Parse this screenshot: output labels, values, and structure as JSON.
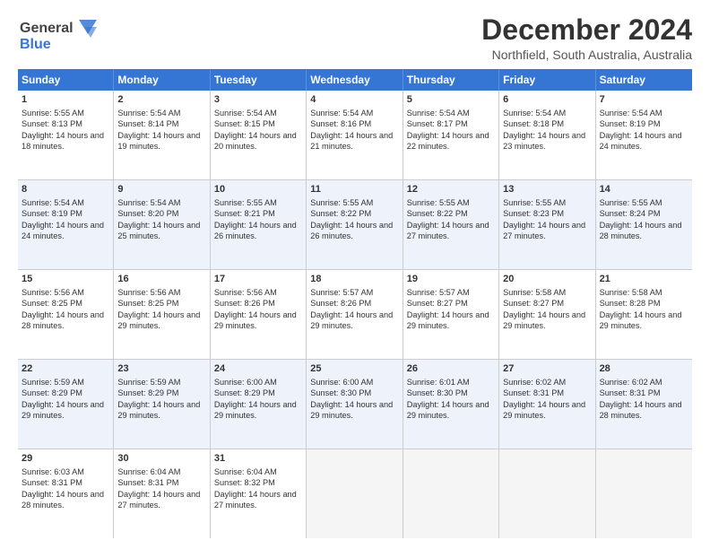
{
  "header": {
    "logo": {
      "line1": "General",
      "line2": "Blue",
      "tagline": ""
    },
    "title": "December 2024",
    "location": "Northfield, South Australia, Australia"
  },
  "calendar": {
    "days": [
      "Sunday",
      "Monday",
      "Tuesday",
      "Wednesday",
      "Thursday",
      "Friday",
      "Saturday"
    ],
    "rows": [
      [
        {
          "day": 1,
          "sunrise": "Sunrise: 5:55 AM",
          "sunset": "Sunset: 8:13 PM",
          "daylight": "Daylight: 14 hours and 18 minutes."
        },
        {
          "day": 2,
          "sunrise": "Sunrise: 5:54 AM",
          "sunset": "Sunset: 8:14 PM",
          "daylight": "Daylight: 14 hours and 19 minutes."
        },
        {
          "day": 3,
          "sunrise": "Sunrise: 5:54 AM",
          "sunset": "Sunset: 8:15 PM",
          "daylight": "Daylight: 14 hours and 20 minutes."
        },
        {
          "day": 4,
          "sunrise": "Sunrise: 5:54 AM",
          "sunset": "Sunset: 8:16 PM",
          "daylight": "Daylight: 14 hours and 21 minutes."
        },
        {
          "day": 5,
          "sunrise": "Sunrise: 5:54 AM",
          "sunset": "Sunset: 8:17 PM",
          "daylight": "Daylight: 14 hours and 22 minutes."
        },
        {
          "day": 6,
          "sunrise": "Sunrise: 5:54 AM",
          "sunset": "Sunset: 8:18 PM",
          "daylight": "Daylight: 14 hours and 23 minutes."
        },
        {
          "day": 7,
          "sunrise": "Sunrise: 5:54 AM",
          "sunset": "Sunset: 8:19 PM",
          "daylight": "Daylight: 14 hours and 24 minutes."
        }
      ],
      [
        {
          "day": 8,
          "sunrise": "Sunrise: 5:54 AM",
          "sunset": "Sunset: 8:19 PM",
          "daylight": "Daylight: 14 hours and 24 minutes."
        },
        {
          "day": 9,
          "sunrise": "Sunrise: 5:54 AM",
          "sunset": "Sunset: 8:20 PM",
          "daylight": "Daylight: 14 hours and 25 minutes."
        },
        {
          "day": 10,
          "sunrise": "Sunrise: 5:55 AM",
          "sunset": "Sunset: 8:21 PM",
          "daylight": "Daylight: 14 hours and 26 minutes."
        },
        {
          "day": 11,
          "sunrise": "Sunrise: 5:55 AM",
          "sunset": "Sunset: 8:22 PM",
          "daylight": "Daylight: 14 hours and 26 minutes."
        },
        {
          "day": 12,
          "sunrise": "Sunrise: 5:55 AM",
          "sunset": "Sunset: 8:22 PM",
          "daylight": "Daylight: 14 hours and 27 minutes."
        },
        {
          "day": 13,
          "sunrise": "Sunrise: 5:55 AM",
          "sunset": "Sunset: 8:23 PM",
          "daylight": "Daylight: 14 hours and 27 minutes."
        },
        {
          "day": 14,
          "sunrise": "Sunrise: 5:55 AM",
          "sunset": "Sunset: 8:24 PM",
          "daylight": "Daylight: 14 hours and 28 minutes."
        }
      ],
      [
        {
          "day": 15,
          "sunrise": "Sunrise: 5:56 AM",
          "sunset": "Sunset: 8:25 PM",
          "daylight": "Daylight: 14 hours and 28 minutes."
        },
        {
          "day": 16,
          "sunrise": "Sunrise: 5:56 AM",
          "sunset": "Sunset: 8:25 PM",
          "daylight": "Daylight: 14 hours and 29 minutes."
        },
        {
          "day": 17,
          "sunrise": "Sunrise: 5:56 AM",
          "sunset": "Sunset: 8:26 PM",
          "daylight": "Daylight: 14 hours and 29 minutes."
        },
        {
          "day": 18,
          "sunrise": "Sunrise: 5:57 AM",
          "sunset": "Sunset: 8:26 PM",
          "daylight": "Daylight: 14 hours and 29 minutes."
        },
        {
          "day": 19,
          "sunrise": "Sunrise: 5:57 AM",
          "sunset": "Sunset: 8:27 PM",
          "daylight": "Daylight: 14 hours and 29 minutes."
        },
        {
          "day": 20,
          "sunrise": "Sunrise: 5:58 AM",
          "sunset": "Sunset: 8:27 PM",
          "daylight": "Daylight: 14 hours and 29 minutes."
        },
        {
          "day": 21,
          "sunrise": "Sunrise: 5:58 AM",
          "sunset": "Sunset: 8:28 PM",
          "daylight": "Daylight: 14 hours and 29 minutes."
        }
      ],
      [
        {
          "day": 22,
          "sunrise": "Sunrise: 5:59 AM",
          "sunset": "Sunset: 8:29 PM",
          "daylight": "Daylight: 14 hours and 29 minutes."
        },
        {
          "day": 23,
          "sunrise": "Sunrise: 5:59 AM",
          "sunset": "Sunset: 8:29 PM",
          "daylight": "Daylight: 14 hours and 29 minutes."
        },
        {
          "day": 24,
          "sunrise": "Sunrise: 6:00 AM",
          "sunset": "Sunset: 8:29 PM",
          "daylight": "Daylight: 14 hours and 29 minutes."
        },
        {
          "day": 25,
          "sunrise": "Sunrise: 6:00 AM",
          "sunset": "Sunset: 8:30 PM",
          "daylight": "Daylight: 14 hours and 29 minutes."
        },
        {
          "day": 26,
          "sunrise": "Sunrise: 6:01 AM",
          "sunset": "Sunset: 8:30 PM",
          "daylight": "Daylight: 14 hours and 29 minutes."
        },
        {
          "day": 27,
          "sunrise": "Sunrise: 6:02 AM",
          "sunset": "Sunset: 8:31 PM",
          "daylight": "Daylight: 14 hours and 29 minutes."
        },
        {
          "day": 28,
          "sunrise": "Sunrise: 6:02 AM",
          "sunset": "Sunset: 8:31 PM",
          "daylight": "Daylight: 14 hours and 28 minutes."
        }
      ],
      [
        {
          "day": 29,
          "sunrise": "Sunrise: 6:03 AM",
          "sunset": "Sunset: 8:31 PM",
          "daylight": "Daylight: 14 hours and 28 minutes."
        },
        {
          "day": 30,
          "sunrise": "Sunrise: 6:04 AM",
          "sunset": "Sunset: 8:31 PM",
          "daylight": "Daylight: 14 hours and 27 minutes."
        },
        {
          "day": 31,
          "sunrise": "Sunrise: 6:04 AM",
          "sunset": "Sunset: 8:32 PM",
          "daylight": "Daylight: 14 hours and 27 minutes."
        },
        null,
        null,
        null,
        null
      ]
    ]
  }
}
